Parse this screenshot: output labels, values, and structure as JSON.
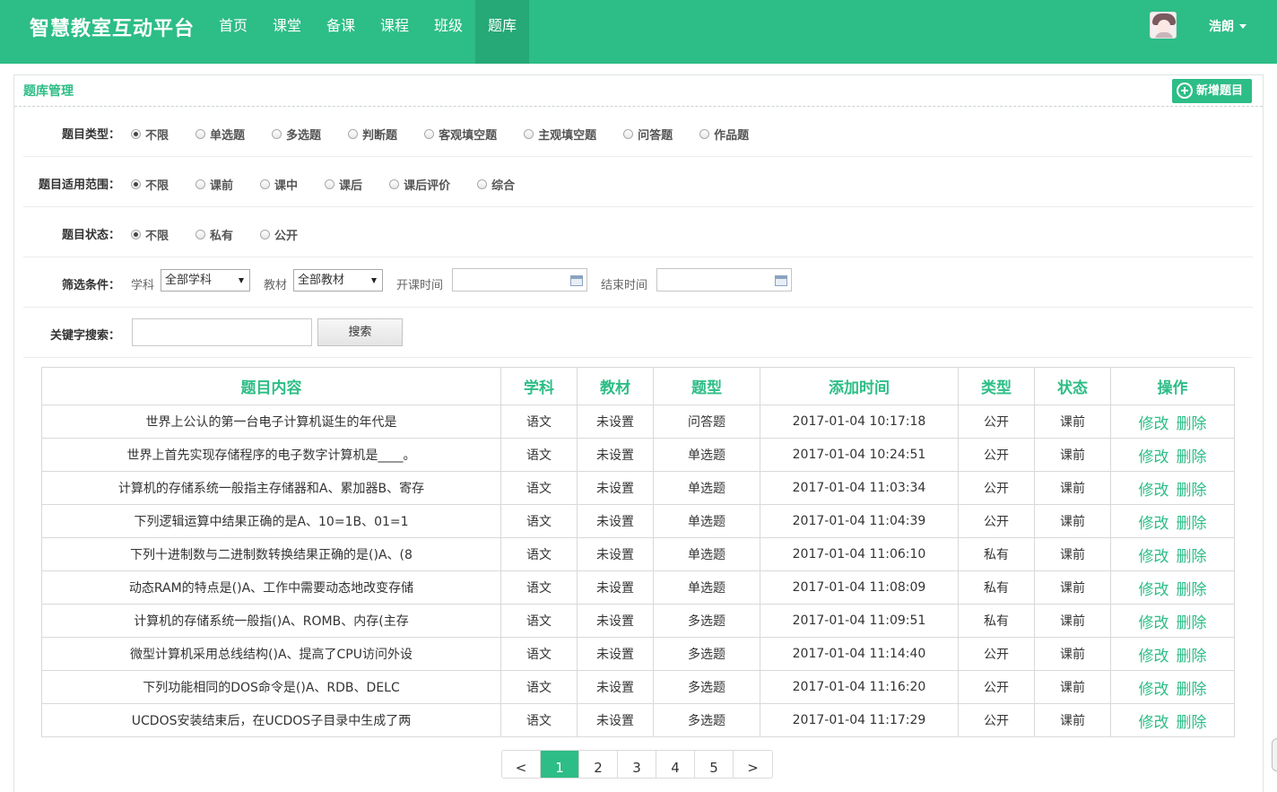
{
  "app": {
    "title": "智慧教室互动平台"
  },
  "nav": [
    {
      "label": "首页",
      "active": false
    },
    {
      "label": "课堂",
      "active": false
    },
    {
      "label": "备课",
      "active": false
    },
    {
      "label": "课程",
      "active": false
    },
    {
      "label": "班级",
      "active": false
    },
    {
      "label": "题库",
      "active": true
    }
  ],
  "user": {
    "name": "浩朗"
  },
  "panel": {
    "title": "题库管理",
    "add_label": "新增题目"
  },
  "filters": {
    "type": {
      "label": "题目类型：",
      "options": [
        "不限",
        "单选题",
        "多选题",
        "判断题",
        "客观填空题",
        "主观填空题",
        "问答题",
        "作品题"
      ],
      "selected": 0
    },
    "scope": {
      "label": "题目适用范围：",
      "options": [
        "不限",
        "课前",
        "课中",
        "课后",
        "课后评价",
        "综合"
      ],
      "selected": 0
    },
    "status": {
      "label": "题目状态：",
      "options": [
        "不限",
        "私有",
        "公开"
      ],
      "selected": 0
    },
    "conditions": {
      "label": "筛选条件：",
      "subject_label": "学科",
      "subject_value": "全部学科",
      "textbook_label": "教材",
      "textbook_value": "全部教材",
      "start_label": "开课时间",
      "end_label": "结束时间"
    },
    "keyword": {
      "label": "关键字搜索：",
      "value": "",
      "search_label": "搜索"
    }
  },
  "table": {
    "headers": [
      "题目内容",
      "学科",
      "教材",
      "题型",
      "添加时间",
      "类型",
      "状态",
      "操作"
    ],
    "edit_label": "修改",
    "delete_label": "删除",
    "rows": [
      [
        "世界上公认的第一台电子计算机诞生的年代是",
        "语文",
        "未设置",
        "问答题",
        "2017-01-04 10:17:18",
        "公开",
        "课前"
      ],
      [
        "世界上首先实现存储程序的电子数字计算机是____。",
        "语文",
        "未设置",
        "单选题",
        "2017-01-04 10:24:51",
        "公开",
        "课前"
      ],
      [
        "计算机的存储系统一般指主存储器和A、累加器B、寄存",
        "语文",
        "未设置",
        "单选题",
        "2017-01-04 11:03:34",
        "公开",
        "课前"
      ],
      [
        "下列逻辑运算中结果正确的是A、10=1B、01=1",
        "语文",
        "未设置",
        "单选题",
        "2017-01-04 11:04:39",
        "公开",
        "课前"
      ],
      [
        "下列十进制数与二进制数转换结果正确的是()A、(8",
        "语文",
        "未设置",
        "单选题",
        "2017-01-04 11:06:10",
        "私有",
        "课前"
      ],
      [
        "动态RAM的特点是()A、工作中需要动态地改变存储",
        "语文",
        "未设置",
        "单选题",
        "2017-01-04 11:08:09",
        "私有",
        "课前"
      ],
      [
        "计算机的存储系统一般指()A、ROMB、内存(主存",
        "语文",
        "未设置",
        "多选题",
        "2017-01-04 11:09:51",
        "私有",
        "课前"
      ],
      [
        "微型计算机采用总线结构()A、提高了CPU访问外设",
        "语文",
        "未设置",
        "多选题",
        "2017-01-04 11:14:40",
        "公开",
        "课前"
      ],
      [
        "下列功能相同的DOS命令是()A、RDB、DELC",
        "语文",
        "未设置",
        "多选题",
        "2017-01-04 11:16:20",
        "公开",
        "课前"
      ],
      [
        "UCDOS安装结束后，在UCDOS子目录中生成了两",
        "语文",
        "未设置",
        "多选题",
        "2017-01-04 11:17:29",
        "公开",
        "课前"
      ]
    ]
  },
  "pagination": {
    "prev": "<",
    "pages": [
      "1",
      "2",
      "3",
      "4",
      "5"
    ],
    "current": "1",
    "next": ">"
  }
}
